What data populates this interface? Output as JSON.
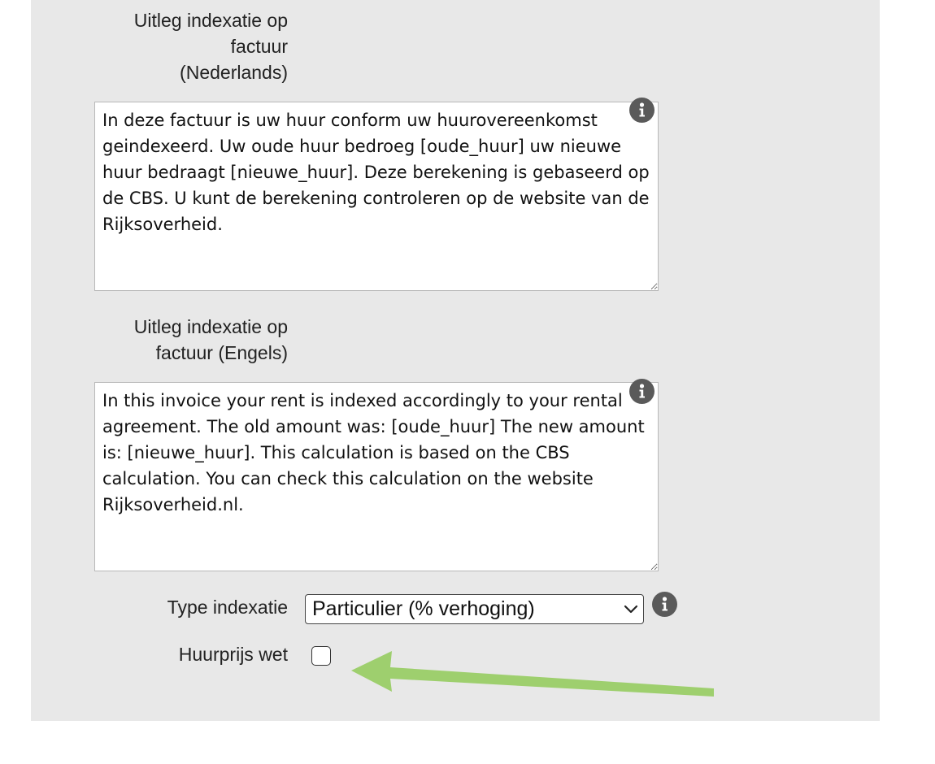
{
  "form": {
    "nl_label": "Uitleg indexatie op\nfactuur\n(Nederlands)",
    "nl_value": "In deze factuur is uw huur conform uw huurovereenkomst geindexeerd. Uw oude huur bedroeg [oude_huur] uw nieuwe huur bedraagt [nieuwe_huur]. Deze berekening is gebaseerd op de CBS. U kunt de berekening controleren op de website van de Rijksoverheid.",
    "en_label": "Uitleg indexatie op\nfactuur (Engels)",
    "en_value": "In this invoice your rent is indexed accordingly to your rental agreement. The old amount was: [oude_huur] The new amount is: [nieuwe_huur]. This calculation is based on the CBS calculation. You can check this calculation on the website Rijksoverheid.nl.",
    "type_label": "Type indexatie",
    "type_selected": "Particulier (% verhoging)",
    "wet_label": "Huurprijs wet",
    "wet_checked": false
  },
  "colors": {
    "panel_bg": "#e8e8e8",
    "info_icon_bg": "#5a5a5a",
    "arrow": "#9ecf6e"
  },
  "icons": {
    "info": "info-icon",
    "chevron": "chevron-down-icon",
    "arrow": "arrow-left-annotation"
  }
}
